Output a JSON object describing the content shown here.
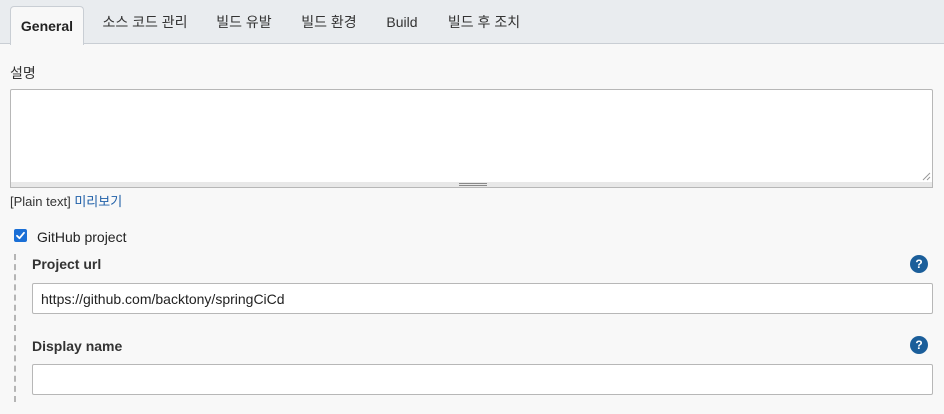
{
  "tabs": [
    {
      "label": "General",
      "active": true
    },
    {
      "label": "소스 코드 관리"
    },
    {
      "label": "빌드 유발"
    },
    {
      "label": "빌드 환경"
    },
    {
      "label": "Build"
    },
    {
      "label": "빌드 후 조치"
    }
  ],
  "description": {
    "label": "설명",
    "value": "",
    "format_text": "[Plain text]",
    "preview_link": "미리보기"
  },
  "github_project": {
    "checked": true,
    "label": "GitHub project",
    "project_url": {
      "label": "Project url",
      "value": "https://github.com/backtony/springCiCd",
      "help": "?"
    },
    "display_name": {
      "label": "Display name",
      "value": "",
      "help": "?"
    }
  },
  "colors": {
    "accent": "#1a6fd6",
    "help_icon": "#1b5e9a",
    "link": "#1f5fa8"
  }
}
